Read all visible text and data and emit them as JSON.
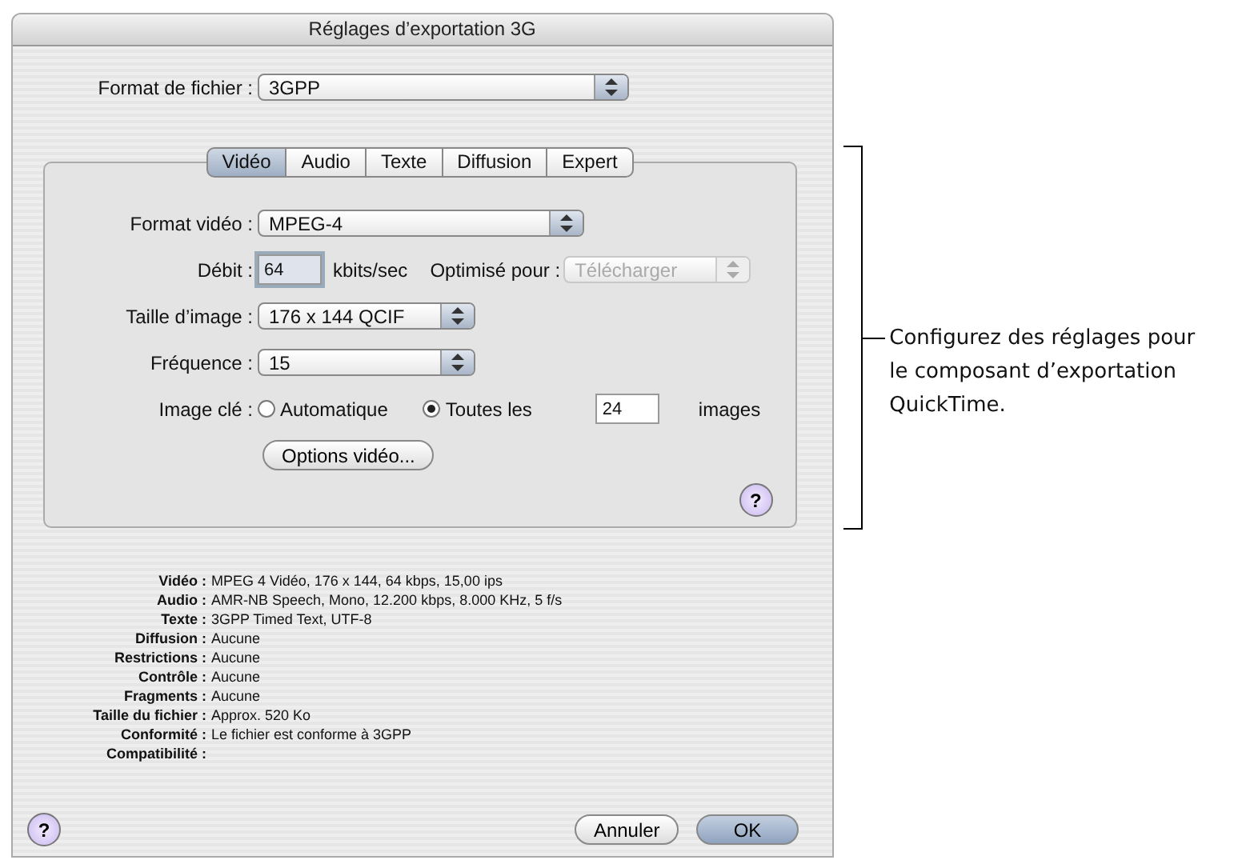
{
  "window": {
    "title": "Réglages d’exportation 3G"
  },
  "file_format": {
    "label": "Format de fichier :",
    "value": "3GPP"
  },
  "tabs": [
    {
      "label": "Vidéo",
      "selected": true
    },
    {
      "label": "Audio",
      "selected": false
    },
    {
      "label": "Texte",
      "selected": false
    },
    {
      "label": "Diffusion",
      "selected": false
    },
    {
      "label": "Expert",
      "selected": false
    }
  ],
  "video": {
    "format": {
      "label": "Format vidéo :",
      "value": "MPEG-4"
    },
    "bitrate": {
      "label": "Débit :",
      "value": "64",
      "unit": "kbits/sec"
    },
    "optimized_for": {
      "label": "Optimisé pour :",
      "value": "Télécharger",
      "disabled": true
    },
    "frame_size": {
      "label": "Taille d’image :",
      "value": "176 x 144 QCIF"
    },
    "frame_rate": {
      "label": "Fréquence :",
      "value": "15"
    },
    "keyframe": {
      "label": "Image clé :",
      "options": [
        {
          "label": "Automatique",
          "selected": false
        },
        {
          "label": "Toutes les",
          "selected": true
        }
      ],
      "interval": "24",
      "unit": "images"
    },
    "options_button": "Options vidéo...",
    "help": "?"
  },
  "summary": [
    {
      "label": "Vidéo :",
      "value": "MPEG 4 Vidéo, 176 x 144, 64 kbps, 15,00 ips"
    },
    {
      "label": "Audio :",
      "value": "AMR-NB Speech, Mono, 12.200 kbps, 8.000 KHz, 5 f/s"
    },
    {
      "label": "Texte :",
      "value": "3GPP Timed Text, UTF-8"
    },
    {
      "label": "Diffusion :",
      "value": "Aucune"
    },
    {
      "label": "Restrictions :",
      "value": "Aucune"
    },
    {
      "label": "Contrôle :",
      "value": "Aucune"
    },
    {
      "label": "Fragments :",
      "value": "Aucune"
    },
    {
      "label": "Taille du fichier :",
      "value": "Approx. 520 Ko"
    },
    {
      "label": "Conformité :",
      "value": "Le fichier est conforme à 3GPP"
    },
    {
      "label": "Compatibilité :"
    }
  ],
  "footer": {
    "help": "?",
    "buttons": [
      {
        "label": "Annuler",
        "default": false
      },
      {
        "label": "OK",
        "default": true
      }
    ]
  },
  "callout": {
    "text": "Configurez des réglages pour le composant d’exportation QuickTime."
  }
}
